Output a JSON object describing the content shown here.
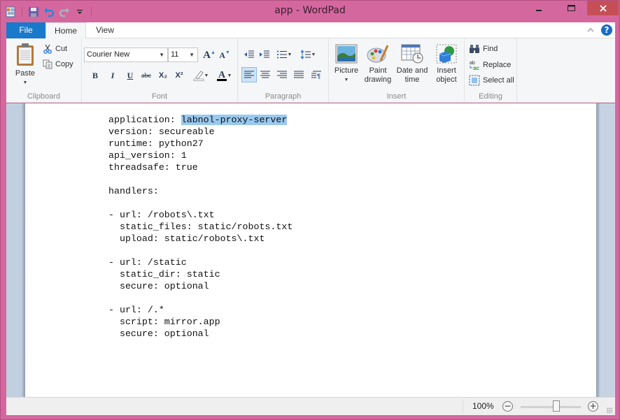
{
  "window": {
    "title": "app - WordPad",
    "controls": {
      "minimize": "—",
      "maximize": "☐",
      "close": "✕"
    }
  },
  "quick_access": [
    {
      "name": "wordpad-app-icon"
    },
    {
      "name": "save-icon"
    },
    {
      "name": "undo-icon"
    },
    {
      "name": "redo-icon"
    },
    {
      "name": "customize-quick-access-icon"
    }
  ],
  "tabs": {
    "file": "File",
    "home": "Home",
    "view": "View",
    "active": "Home"
  },
  "ribbon": {
    "clipboard": {
      "label": "Clipboard",
      "paste": "Paste",
      "cut": "Cut",
      "copy": "Copy"
    },
    "font": {
      "label": "Font",
      "family": "Courier New",
      "size": "11",
      "bold": "B",
      "italic": "I",
      "underline": "U",
      "strikethrough": "abc",
      "subscript": "X₂",
      "superscript": "X²",
      "grow": "A",
      "shrink": "A"
    },
    "paragraph": {
      "label": "Paragraph",
      "active_alignment": "left"
    },
    "insert": {
      "label": "Insert",
      "picture": "Picture",
      "paint_line1": "Paint",
      "paint_line2": "drawing",
      "datetime_line1": "Date and",
      "datetime_line2": "time",
      "object_line1": "Insert",
      "object_line2": "object"
    },
    "editing": {
      "label": "Editing",
      "find": "Find",
      "replace": "Replace",
      "select_all": "Select all"
    }
  },
  "document": {
    "lines": [
      {
        "prefix": "application: ",
        "selected": "labnol-proxy-server"
      },
      {
        "text": "version: secureable"
      },
      {
        "text": "runtime: python27"
      },
      {
        "text": "api_version: 1"
      },
      {
        "text": "threadsafe: true"
      },
      {
        "text": ""
      },
      {
        "text": "handlers:"
      },
      {
        "text": ""
      },
      {
        "text": "- url: /robots\\.txt"
      },
      {
        "text": "  static_files: static/robots.txt"
      },
      {
        "text": "  upload: static/robots\\.txt"
      },
      {
        "text": ""
      },
      {
        "text": "- url: /static"
      },
      {
        "text": "  static_dir: static"
      },
      {
        "text": "  secure: optional"
      },
      {
        "text": ""
      },
      {
        "text": "- url: /.*"
      },
      {
        "text": "  script: mirror.app"
      },
      {
        "text": "  secure: optional"
      }
    ]
  },
  "status": {
    "zoom": "100%",
    "zoom_out": "−",
    "zoom_in": "+",
    "zoom_percent": 100
  },
  "colors": {
    "titlebar": "#d5679f",
    "file_tab": "#1979ca",
    "close_button": "#c64f57",
    "selection": "#99c9ef"
  }
}
